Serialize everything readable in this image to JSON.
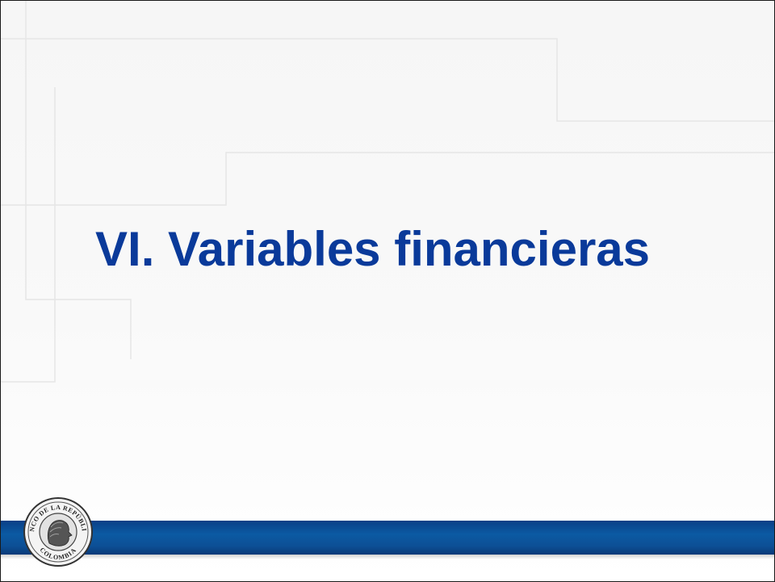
{
  "slide": {
    "title": "VI. Variables financieras",
    "title_color": "#0a3a9a",
    "band_color": "#0b4f9a",
    "logo": {
      "text_top": "BANCO DE LA REPÚBLICA",
      "text_bottom": "COLOMBIA"
    }
  }
}
